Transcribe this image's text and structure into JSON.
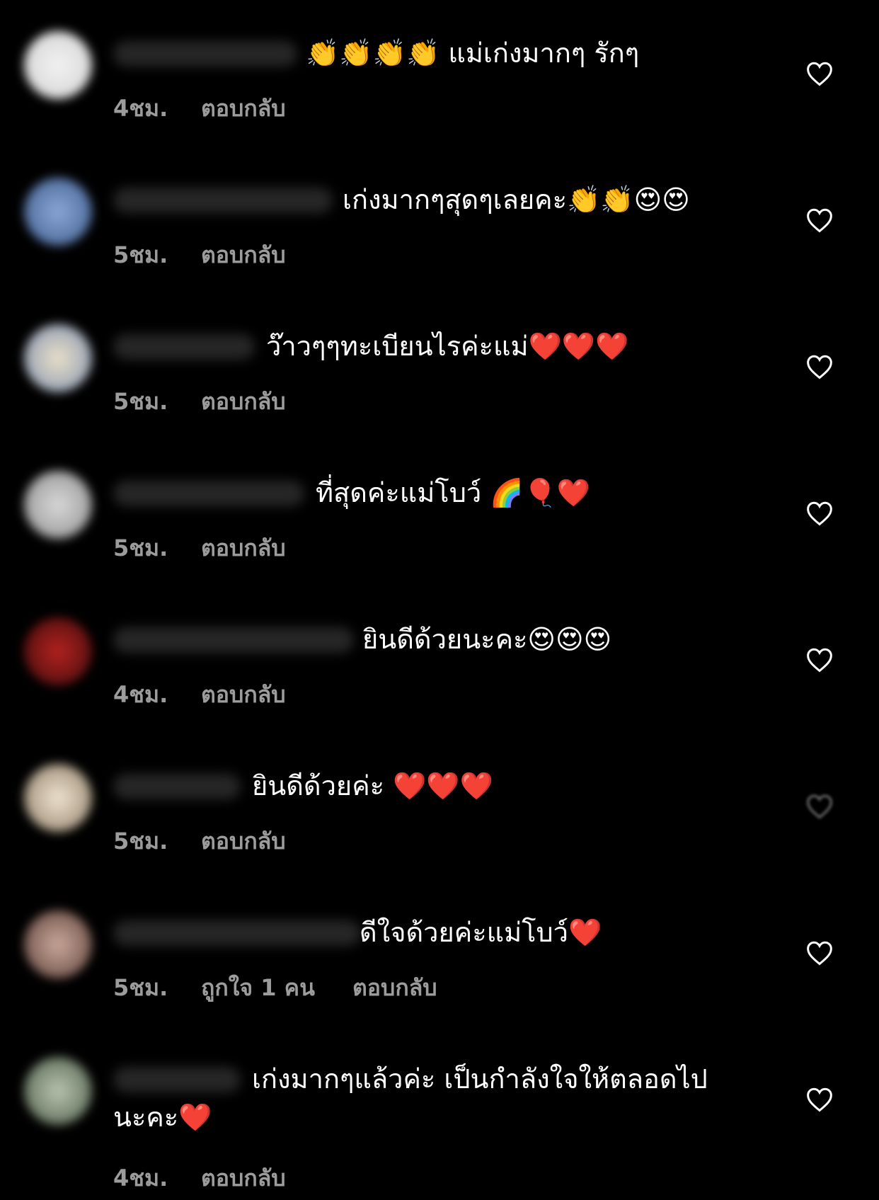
{
  "comments": [
    {
      "text": "👏👏👏👏 แม่เก่งมากๆ รักๆ",
      "time": "4ชม.",
      "reply": "ตอบกลับ",
      "likes": ""
    },
    {
      "text": "เก่งมากๆสุดๆเลยคะ👏👏😍😍",
      "time": "5ชม.",
      "reply": "ตอบกลับ",
      "likes": ""
    },
    {
      "text": "ว๊าวๆๆทะเบียนไรค่ะแม่❤️❤️❤️",
      "time": "5ชม.",
      "reply": "ตอบกลับ",
      "likes": ""
    },
    {
      "text": "ที่สุดค่ะแม่โบว์ 🌈🎈❤️",
      "time": "5ชม.",
      "reply": "ตอบกลับ",
      "likes": ""
    },
    {
      "text": "ยินดีด้วยนะคะ😍😍😍",
      "time": "4ชม.",
      "reply": "ตอบกลับ",
      "likes": ""
    },
    {
      "text": "ยินดีด้วยค่ะ ❤️❤️❤️",
      "time": "5ชม.",
      "reply": "ตอบกลับ",
      "likes": ""
    },
    {
      "text": "ดีใจด้วยค่ะแม่โบว์❤️",
      "time": "5ชม.",
      "reply": "ตอบกลับ",
      "likes": "ถูกใจ 1 คน"
    },
    {
      "text": "เก่งมากๆแล้วค่ะ เป็นกำลังใจให้ตลอดไป",
      "text2": "นะคะ❤️",
      "time": "4ชม.",
      "reply": "ตอบกลับ",
      "likes": ""
    }
  ],
  "icons": {
    "like": "heart-outline-icon"
  }
}
